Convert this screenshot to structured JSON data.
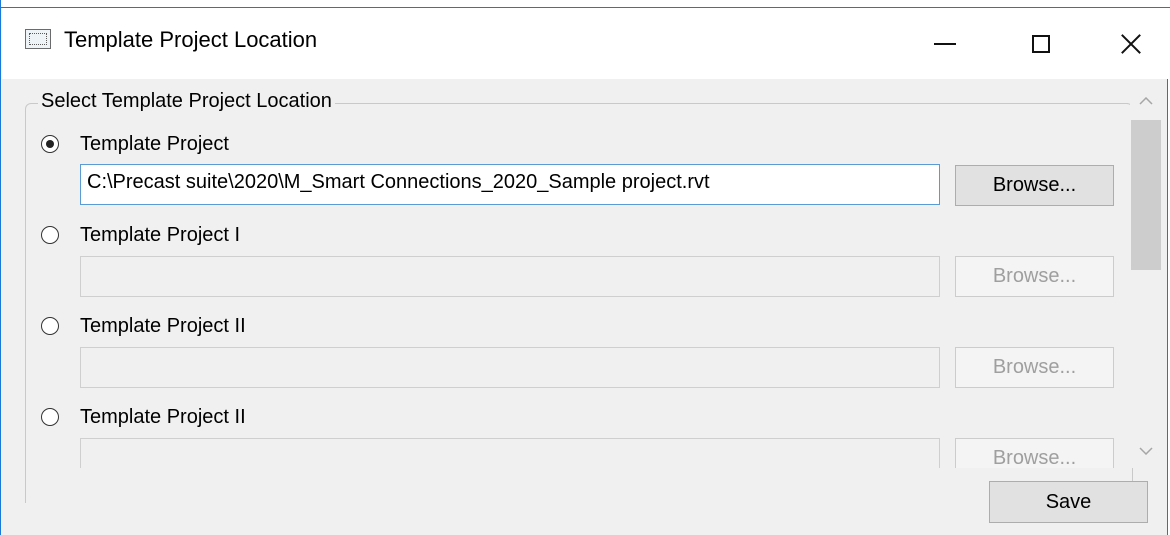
{
  "window": {
    "title": "Template Project Location"
  },
  "group": {
    "legend": "Select Template Project Location"
  },
  "entries": [
    {
      "label": "Template Project",
      "selected": true,
      "path": "C:\\Precast suite\\2020\\M_Smart Connections_2020_Sample project.rvt",
      "browse_label": "Browse...",
      "enabled": true
    },
    {
      "label": "Template Project I",
      "selected": false,
      "path": "",
      "browse_label": "Browse...",
      "enabled": false
    },
    {
      "label": "Template Project II",
      "selected": false,
      "path": "",
      "browse_label": "Browse...",
      "enabled": false
    },
    {
      "label": "Template Project II",
      "selected": false,
      "path": "",
      "browse_label": "Browse...",
      "enabled": false
    }
  ],
  "footer": {
    "save_label": "Save"
  },
  "icons": {
    "app": "window-form-icon",
    "minimize": "minimize-icon",
    "maximize": "maximize-icon",
    "close": "close-icon",
    "scroll_up": "chevron-up-icon",
    "scroll_down": "chevron-down-icon"
  },
  "colors": {
    "window_border": "#1a79d6",
    "focus_border": "#5b9bd5",
    "dialog_bg": "#f0f0f0"
  }
}
